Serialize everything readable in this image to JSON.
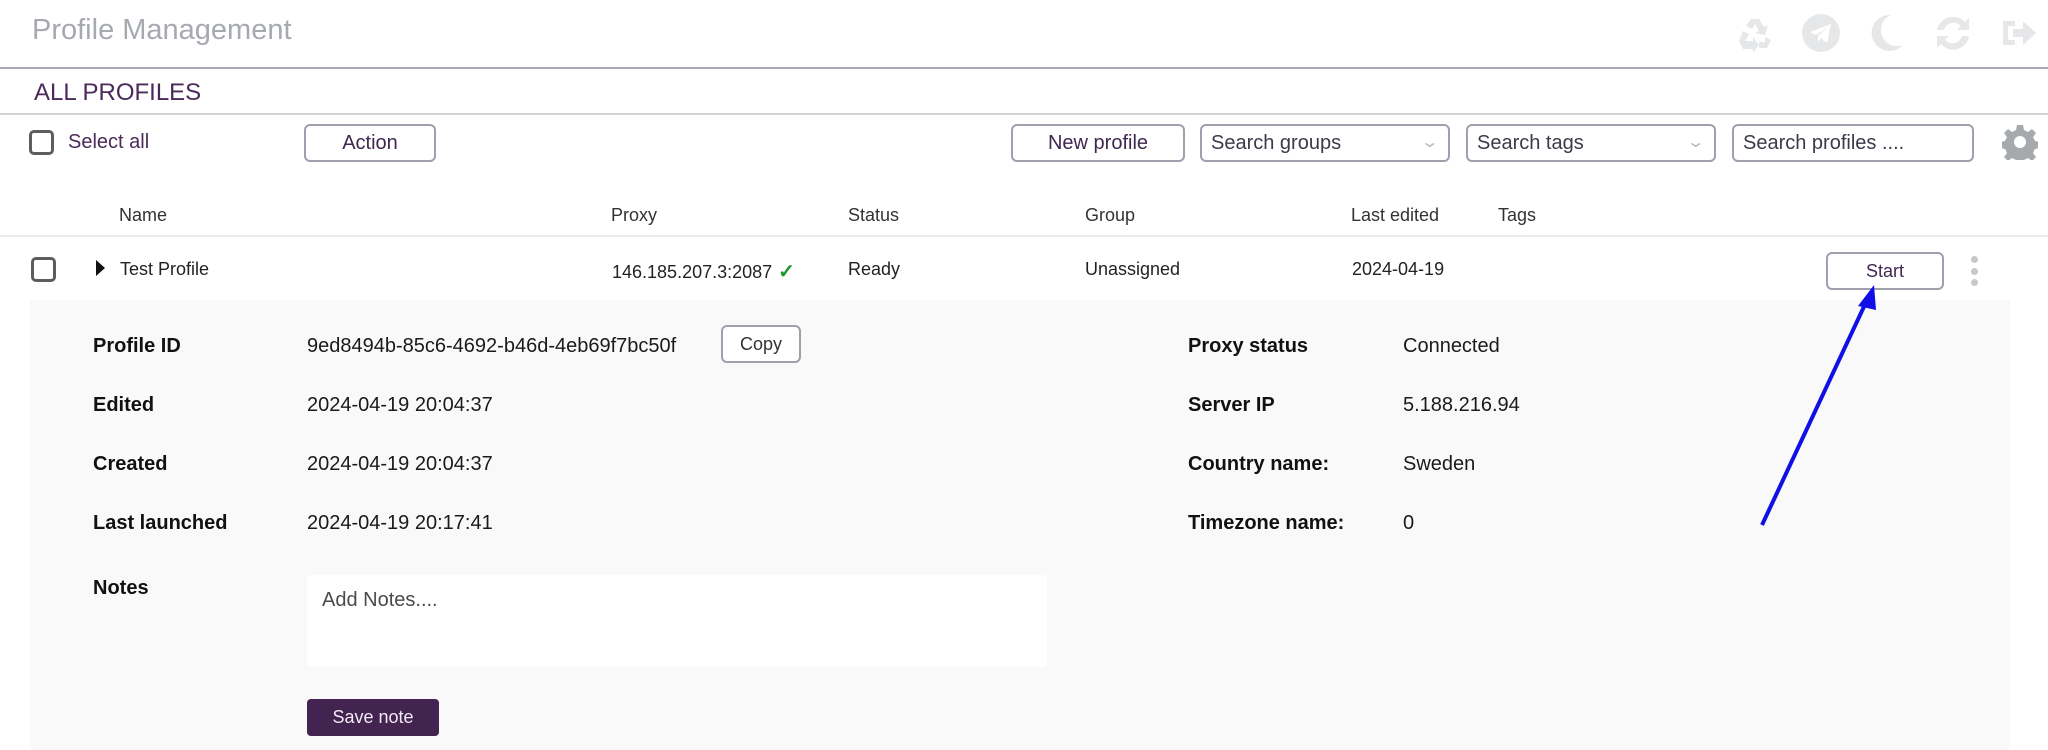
{
  "app": {
    "title": "Profile Management",
    "top_icons": [
      "recycle-icon",
      "telegram-icon",
      "moon-icon",
      "refresh-icon",
      "logout-icon"
    ]
  },
  "section": {
    "title": "ALL PROFILES"
  },
  "toolbar": {
    "select_all_label": "Select all",
    "action_label": "Action",
    "new_profile_label": "New profile",
    "search_groups_placeholder": "Search groups",
    "search_tags_placeholder": "Search tags",
    "search_profiles_placeholder": "Search profiles ....",
    "settings_icon": "gear-icon"
  },
  "table": {
    "columns": [
      "Name",
      "Proxy",
      "Status",
      "Group",
      "Last edited",
      "Tags"
    ],
    "rows": [
      {
        "name": "Test Profile",
        "proxy": "146.185.207.3:2087",
        "proxy_ok_icon": "✓",
        "status": "Ready",
        "group": "Unassigned",
        "last_edited": "2024-04-19",
        "tags": "",
        "start_label": "Start"
      }
    ]
  },
  "details": {
    "profile_id_label": "Profile ID",
    "profile_id": "9ed8494b-85c6-4692-b46d-4eb69f7bc50f",
    "copy_label": "Copy",
    "edited_label": "Edited",
    "edited": "2024-04-19 20:04:37",
    "created_label": "Created",
    "created": "2024-04-19 20:04:37",
    "last_launched_label": "Last launched",
    "last_launched": "2024-04-19 20:17:41",
    "notes_label": "Notes",
    "notes_placeholder": "Add Notes....",
    "notes_value": "",
    "save_note_label": "Save note",
    "proxy_status_label": "Proxy status",
    "proxy_status": "Connected",
    "server_ip_label": "Server IP",
    "server_ip": "5.188.216.94",
    "country_label": "Country name:",
    "country": "Sweden",
    "timezone_label": "Timezone name:",
    "timezone": "0"
  },
  "colors": {
    "brand": "#432350",
    "accent_text": "#4a2a5a",
    "success": "#1a9a2a",
    "annotation_arrow": "#1010e6"
  }
}
